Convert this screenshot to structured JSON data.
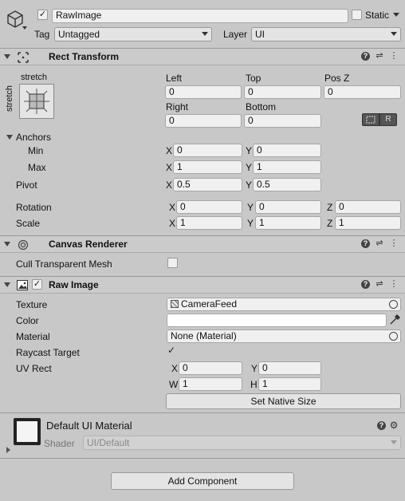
{
  "gameobject": {
    "name": "RawImage",
    "static_label": "Static",
    "tag_label": "Tag",
    "tag_value": "Untagged",
    "layer_label": "Layer",
    "layer_value": "UI"
  },
  "rect_transform": {
    "title": "Rect Transform",
    "anchor_preset_top": "stretch",
    "anchor_preset_side": "stretch",
    "left_label": "Left",
    "left_value": "0",
    "top_label": "Top",
    "top_value": "0",
    "posz_label": "Pos Z",
    "posz_value": "0",
    "right_label": "Right",
    "right_value": "0",
    "bottom_label": "Bottom",
    "bottom_value": "0",
    "anchors_label": "Anchors",
    "min_label": "Min",
    "min_x": "0",
    "min_y": "0",
    "max_label": "Max",
    "max_x": "1",
    "max_y": "1",
    "pivot_label": "Pivot",
    "pivot_x": "0.5",
    "pivot_y": "0.5",
    "rotation_label": "Rotation",
    "rot_x": "0",
    "rot_y": "0",
    "rot_z": "0",
    "scale_label": "Scale",
    "scale_x": "1",
    "scale_y": "1",
    "scale_z": "1",
    "raw_btn": "R"
  },
  "axis": {
    "x": "X",
    "y": "Y",
    "z": "Z",
    "w": "W",
    "h": "H"
  },
  "canvas_renderer": {
    "title": "Canvas Renderer",
    "cull_label": "Cull Transparent Mesh"
  },
  "raw_image": {
    "title": "Raw Image",
    "texture_label": "Texture",
    "texture_value": "CameraFeed",
    "color_label": "Color",
    "material_label": "Material",
    "material_value": "None (Material)",
    "raycast_label": "Raycast Target",
    "uvrect_label": "UV Rect",
    "uv_x": "0",
    "uv_y": "0",
    "uv_w": "1",
    "uv_h": "1",
    "native_size_btn": "Set Native Size"
  },
  "material": {
    "title": "Default UI Material",
    "shader_label": "Shader",
    "shader_value": "UI/Default"
  },
  "add_component_btn": "Add Component",
  "colors": {
    "background": "#c8c8c8",
    "field": "#f0f0f0",
    "header": "#cbcbcb"
  }
}
